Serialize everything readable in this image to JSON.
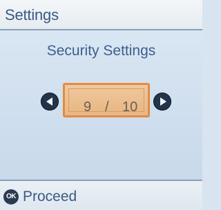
{
  "header": {
    "title": "Settings"
  },
  "main": {
    "section_title": "Security Settings",
    "selector": {
      "current": "9",
      "separator": "/",
      "total": "10"
    }
  },
  "footer": {
    "ok_badge": "OK",
    "action_label": "Proceed"
  },
  "colors": {
    "accent_orange": "#e58a3f",
    "title_blue": "#3a5a84",
    "background_blue": "#d8e4f0"
  },
  "icons": {
    "left": "arrow-left-icon",
    "right": "arrow-right-icon",
    "ok": "ok-button-icon"
  }
}
